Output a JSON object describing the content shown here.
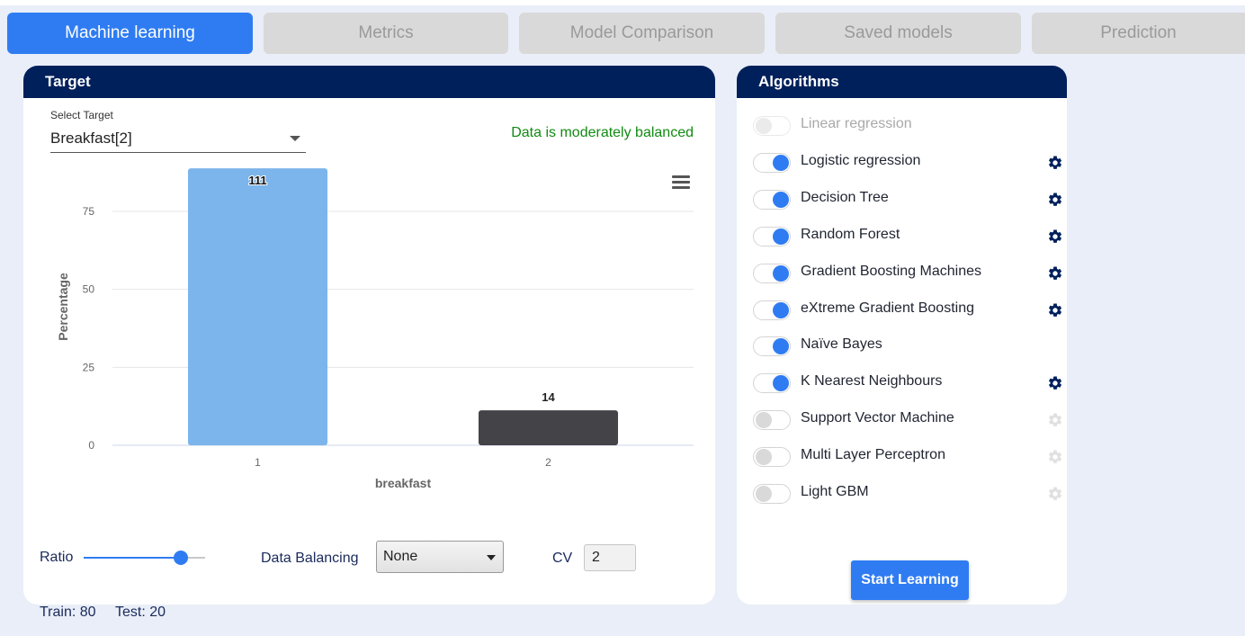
{
  "tabs": [
    {
      "label": "Machine learning",
      "active": true
    },
    {
      "label": "Metrics",
      "active": false
    },
    {
      "label": "Model Comparison",
      "active": false
    },
    {
      "label": "Saved models",
      "active": false
    },
    {
      "label": "Prediction",
      "active": false
    }
  ],
  "target_panel": {
    "title": "Target",
    "select_label": "Select Target",
    "select_value": "Breakfast[2]",
    "balance_status": "Data is moderately balanced",
    "status_color": "#118a11"
  },
  "chart_data": {
    "type": "bar",
    "title": "",
    "xlabel": "breakfast",
    "ylabel": "Percentage",
    "categories": [
      "1",
      "2"
    ],
    "values": [
      88.8,
      11.2
    ],
    "data_labels": [
      "111",
      "14"
    ],
    "colors": [
      "#7cb5ec",
      "#434348"
    ],
    "yticks": [
      0,
      25,
      50,
      75
    ],
    "ylim": [
      0,
      90
    ],
    "grid": true,
    "legend": "none"
  },
  "controls": {
    "ratio_label": "Ratio",
    "ratio_value": 0.8,
    "data_balancing_label": "Data Balancing",
    "data_balancing_value": "None",
    "cv_label": "CV",
    "cv_value": "2",
    "train_text": "Train: 80",
    "test_text": "Test: 20"
  },
  "algorithms_panel": {
    "title": "Algorithms",
    "items": [
      {
        "label": "Linear regression",
        "enabled": false,
        "disabled": true,
        "gear": "none"
      },
      {
        "label": "Logistic regression",
        "enabled": true,
        "disabled": false,
        "gear": "active"
      },
      {
        "label": "Decision Tree",
        "enabled": true,
        "disabled": false,
        "gear": "active"
      },
      {
        "label": "Random Forest",
        "enabled": true,
        "disabled": false,
        "gear": "active"
      },
      {
        "label": "Gradient Boosting Machines",
        "enabled": true,
        "disabled": false,
        "gear": "active"
      },
      {
        "label": "eXtreme Gradient Boosting",
        "enabled": true,
        "disabled": false,
        "gear": "active"
      },
      {
        "label": "Naïve Bayes",
        "enabled": true,
        "disabled": false,
        "gear": "none"
      },
      {
        "label": "K Nearest Neighbours",
        "enabled": true,
        "disabled": false,
        "gear": "active"
      },
      {
        "label": "Support Vector Machine",
        "enabled": false,
        "disabled": false,
        "gear": "inactive"
      },
      {
        "label": "Multi Layer Perceptron",
        "enabled": false,
        "disabled": false,
        "gear": "inactive"
      },
      {
        "label": "Light GBM",
        "enabled": false,
        "disabled": false,
        "gear": "inactive"
      }
    ],
    "start_button_label": "Start Learning"
  },
  "colors": {
    "accent": "#2f7cf2",
    "header": "#00205b",
    "gear_active": "#00205b",
    "gear_inactive": "#e0e0e0"
  },
  "icons": {
    "gear": "gear-icon",
    "menu": "hamburger-menu-icon",
    "caret": "chevron-down-icon"
  }
}
